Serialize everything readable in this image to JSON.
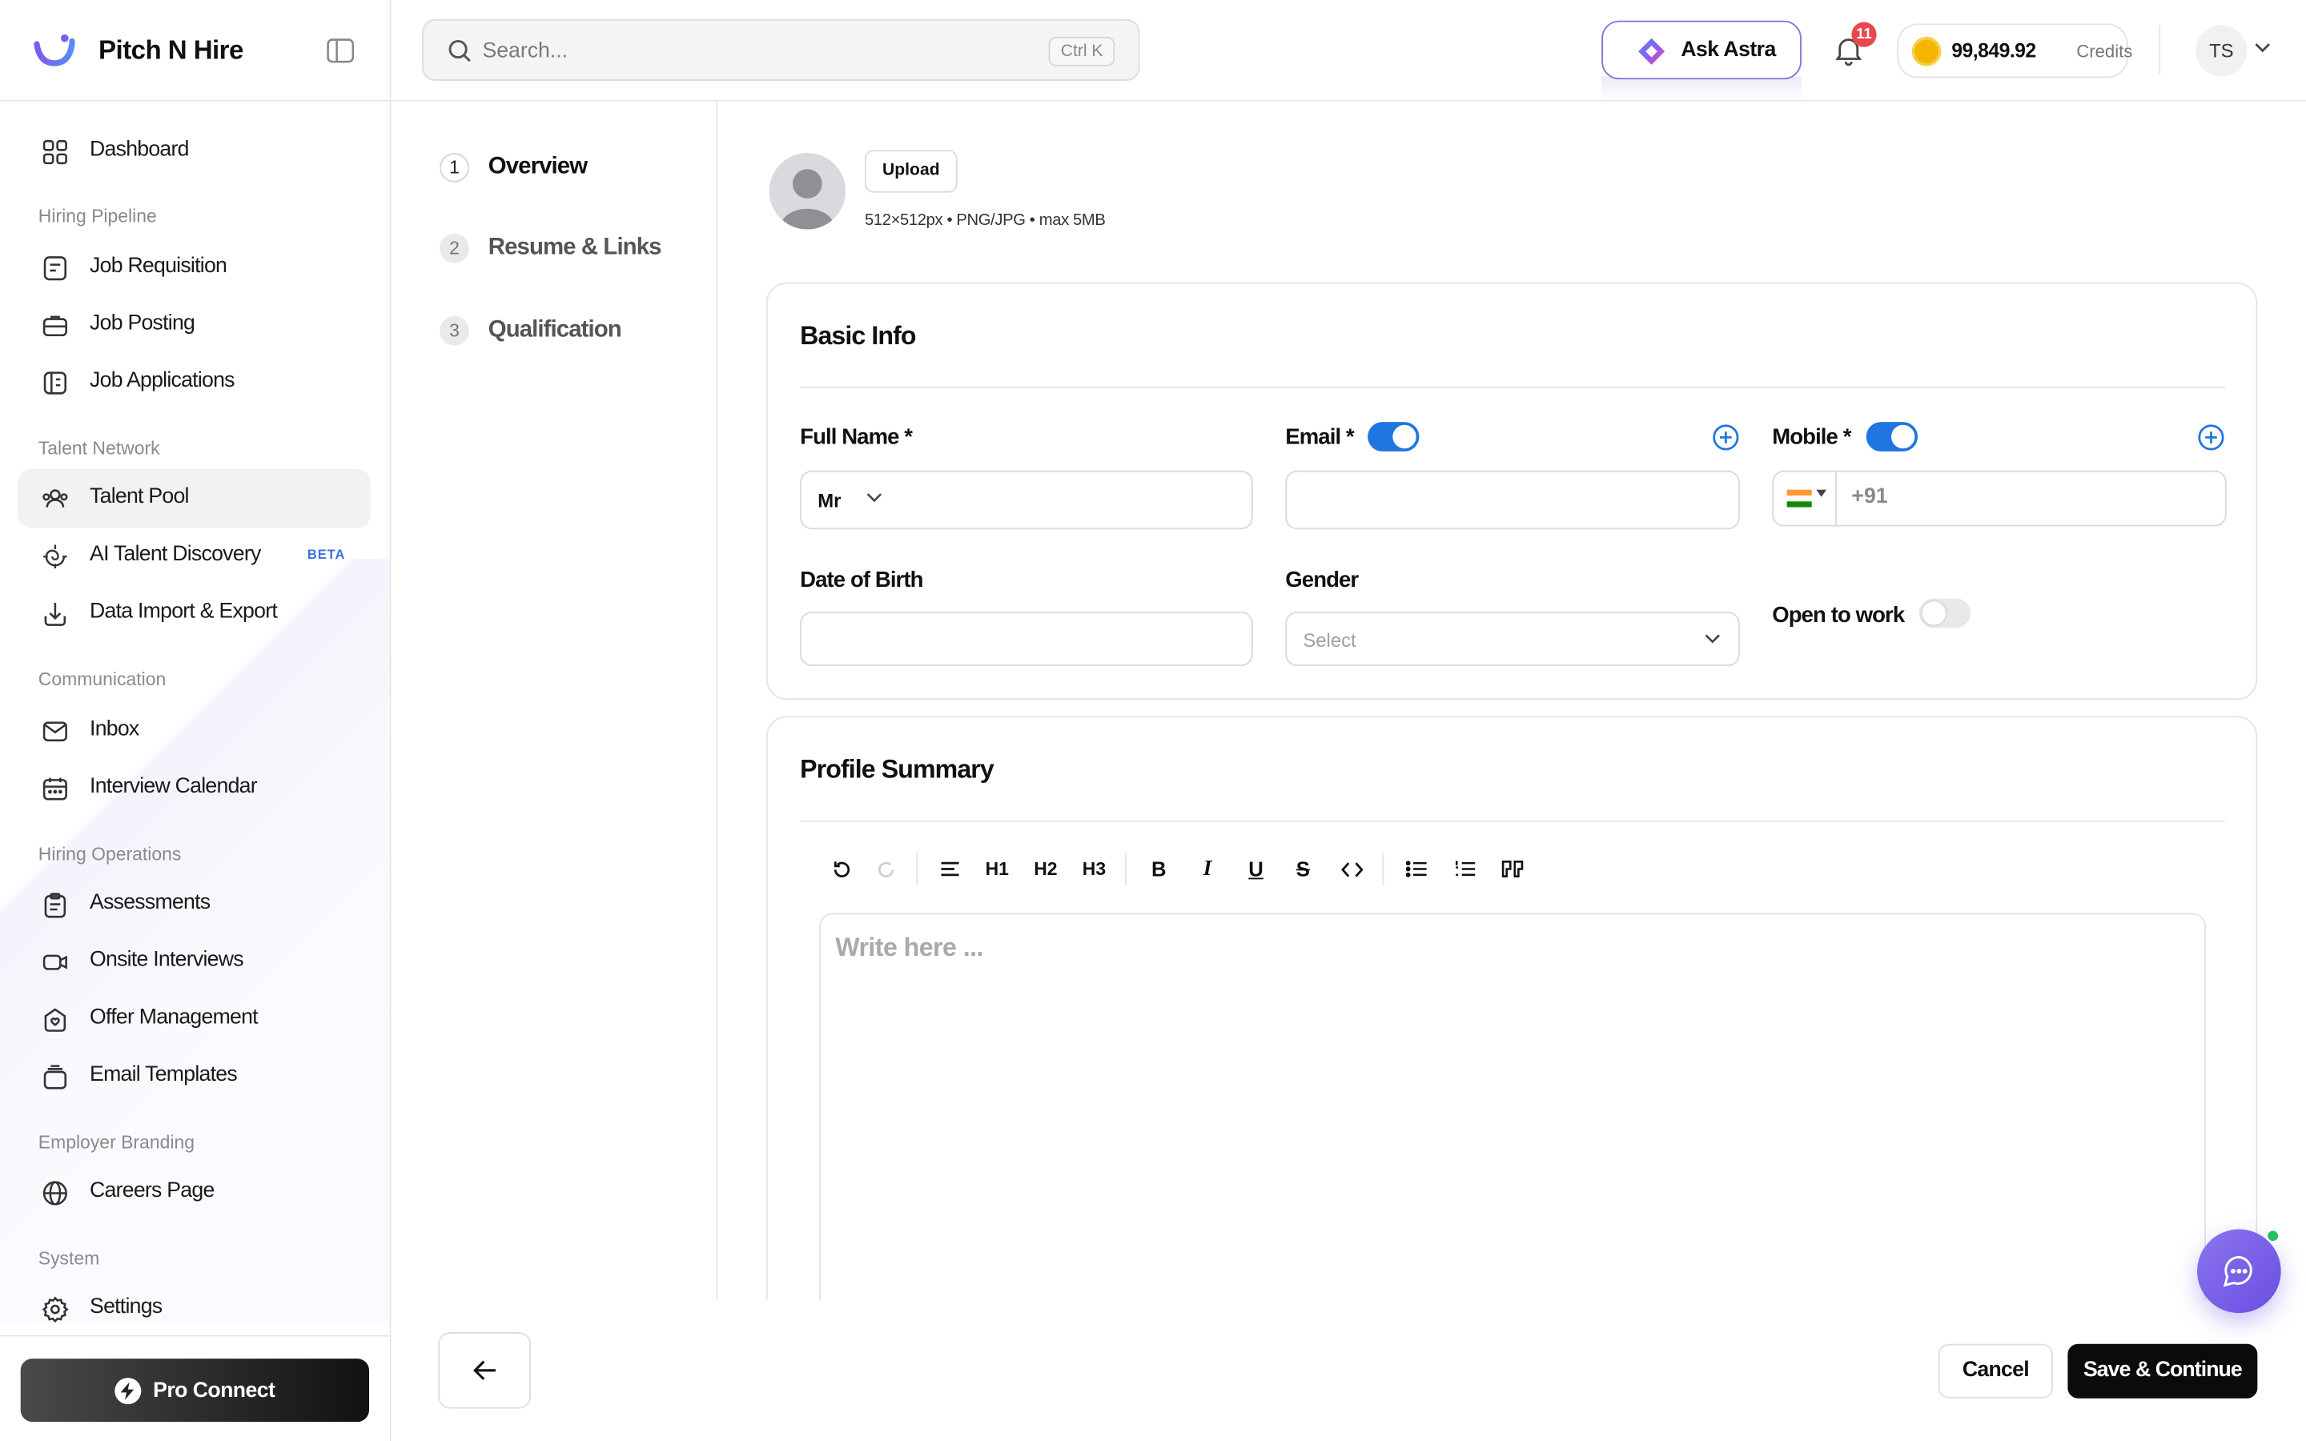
{
  "app": {
    "name": "Pitch N Hire"
  },
  "sidebar": {
    "items": [
      {
        "label": "Dashboard",
        "icon": "dashboard-icon"
      },
      {
        "label": "Job Requisition",
        "icon": "requisition-icon"
      },
      {
        "label": "Job Posting",
        "icon": "briefcase-icon"
      },
      {
        "label": "Job Applications",
        "icon": "applications-icon"
      },
      {
        "label": "Talent Pool",
        "icon": "users-icon"
      },
      {
        "label": "AI Talent Discovery",
        "icon": "spiral-icon",
        "badge": "BETA"
      },
      {
        "label": "Data Import & Export",
        "icon": "import-icon"
      },
      {
        "label": "Inbox",
        "icon": "mail-icon"
      },
      {
        "label": "Interview Calendar",
        "icon": "calendar-icon"
      },
      {
        "label": "Assessments",
        "icon": "clipboard-icon"
      },
      {
        "label": "Onsite Interviews",
        "icon": "video-icon"
      },
      {
        "label": "Offer Management",
        "icon": "offer-icon"
      },
      {
        "label": "Email Templates",
        "icon": "templates-icon"
      },
      {
        "label": "Careers Page",
        "icon": "globe-icon"
      },
      {
        "label": "Settings",
        "icon": "gear-icon"
      }
    ],
    "sections": [
      "Hiring Pipeline",
      "Talent Network",
      "Communication",
      "Hiring Operations",
      "Employer Branding",
      "System"
    ],
    "active": "Talent Pool",
    "pro_connect": "Pro Connect"
  },
  "topbar": {
    "search_placeholder": "Search...",
    "search_shortcut": "Ctrl K",
    "ask_astra": "Ask Astra",
    "notifications": "11",
    "credits_amount": "99,849.92",
    "credits_label": "Credits",
    "user_initials": "TS"
  },
  "steps": [
    {
      "num": "1",
      "label": "Overview",
      "state": "active"
    },
    {
      "num": "2",
      "label": "Resume & Links",
      "state": "pending"
    },
    {
      "num": "3",
      "label": "Qualification",
      "state": "pending"
    }
  ],
  "photo": {
    "upload_label": "Upload",
    "hint": "512×512px • PNG/JPG • max 5MB"
  },
  "basic_info": {
    "title": "Basic Info",
    "full_name_label": "Full Name *",
    "salutation": "Mr",
    "email_label": "Email *",
    "email_toggle": true,
    "mobile_label": "Mobile *",
    "mobile_toggle": true,
    "country_code": "+91",
    "dob_label": "Date of Birth",
    "gender_label": "Gender",
    "gender_placeholder": "Select",
    "open_to_work_label": "Open to work",
    "open_to_work": false
  },
  "profile_summary": {
    "title": "Profile Summary",
    "toolbar": [
      "undo",
      "redo",
      "align",
      "H1",
      "H2",
      "H3",
      "B",
      "I",
      "U",
      "S",
      "code",
      "bullet-list",
      "ordered-list",
      "quote"
    ],
    "placeholder": "Write here ..."
  },
  "footer": {
    "cancel": "Cancel",
    "save": "Save & Continue"
  },
  "colors": {
    "accent": "#1f76e0",
    "primary_button": "#0b0b0b",
    "chat": "#7b61ea",
    "badge": "#e5484d"
  }
}
